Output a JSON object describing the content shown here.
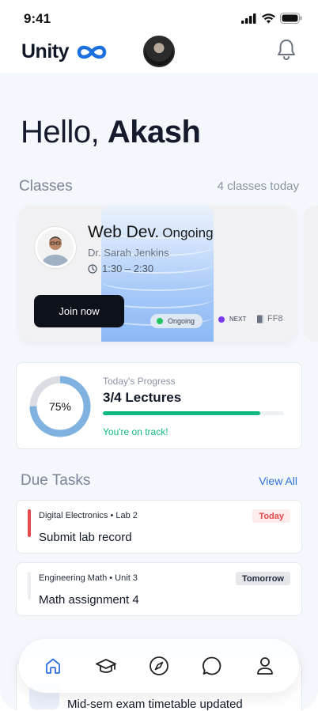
{
  "status_bar": {
    "time": "9:41"
  },
  "header": {
    "brand": "Unity"
  },
  "greeting": {
    "prefix": "Hello,",
    "name": "Akash"
  },
  "classes": {
    "title": "Classes",
    "meta": "4 classes today",
    "card": {
      "subject": "Web Dev.",
      "status": "Ongoing",
      "teacher": "Dr. Sarah Jenkins",
      "time": "1:30 – 2:30",
      "join_label": "Join now",
      "tag_ongoing": "Ongoing",
      "tag_next": "NEXT",
      "room": "FF8",
      "colors": {
        "ongoing_dot": "#22c55e",
        "next_dot": "#7c3aed"
      }
    }
  },
  "progress": {
    "label": "Today's Progress",
    "percent_text": "75%",
    "percent": 75,
    "value": "3/4 Lectures",
    "bar_fraction": 0.87,
    "note": "You're on track!"
  },
  "due_tasks": {
    "title": "Due Tasks",
    "link": "View All",
    "items": [
      {
        "sub": "Digital Electronics • Lab 2",
        "title": "Submit lab record",
        "badge": "Today",
        "stripe": "#e5484d",
        "badge_bg": "#fdecec",
        "badge_fg": "#e5484d"
      },
      {
        "sub": "Engineering Math • Unit 3",
        "title": "Math assignment 4",
        "badge": "Tomorrow",
        "stripe": "#e5e7eb",
        "badge_bg": "#e5e7eb",
        "badge_fg": "#1f2937"
      }
    ]
  },
  "announcements": {
    "item_title": "Mid-sem exam timetable updated"
  },
  "tabbar": {
    "tabs": [
      "home-icon",
      "graduation-cap-icon",
      "compass-icon",
      "chat-icon",
      "profile-icon"
    ]
  }
}
